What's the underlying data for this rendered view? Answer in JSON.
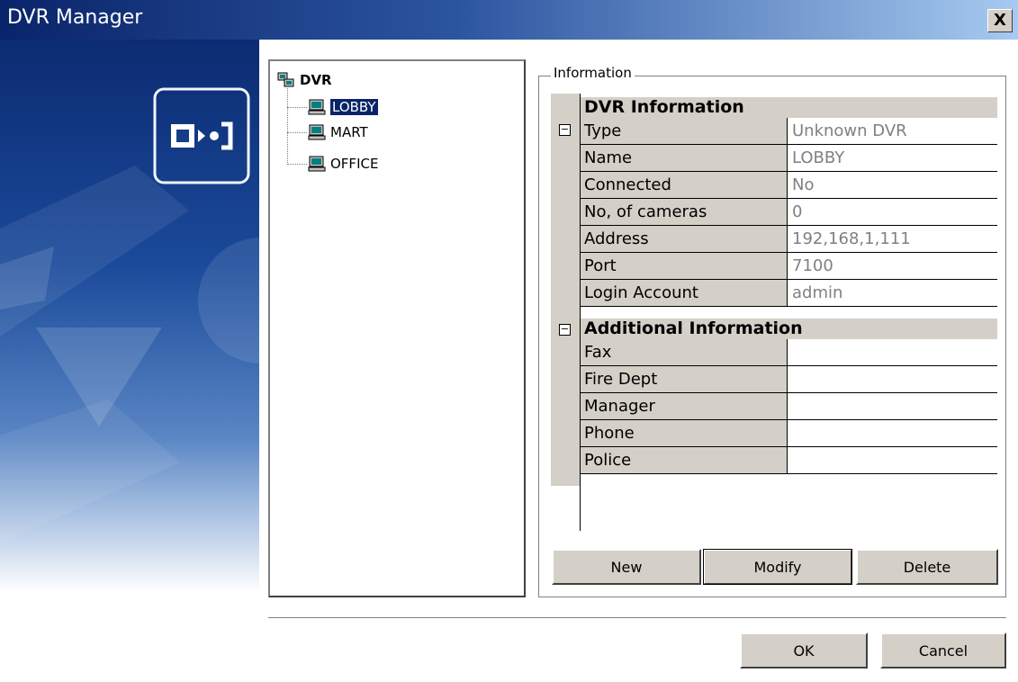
{
  "window": {
    "title": "DVR Manager",
    "close_label": "X"
  },
  "tree": {
    "root": "DVR",
    "items": [
      {
        "label": "LOBBY"
      },
      {
        "label": "MART"
      },
      {
        "label": "OFFICE"
      }
    ]
  },
  "info": {
    "group_label": "Information",
    "dvr_section": {
      "title": "DVR Information",
      "rows": [
        {
          "name": "Type",
          "value": "Unknown DVR"
        },
        {
          "name": "Name",
          "value": "LOBBY"
        },
        {
          "name": "Connected",
          "value": "No"
        },
        {
          "name": "No, of cameras",
          "value": "0"
        },
        {
          "name": "Address",
          "value": "192,168,1,111"
        },
        {
          "name": "Port",
          "value": "7100"
        },
        {
          "name": "Login Account",
          "value": "admin"
        }
      ]
    },
    "additional_section": {
      "title": "Additional Information",
      "rows": [
        {
          "name": "Fax",
          "value": ""
        },
        {
          "name": "Fire Dept",
          "value": ""
        },
        {
          "name": "Manager",
          "value": ""
        },
        {
          "name": "Phone",
          "value": ""
        },
        {
          "name": "Police",
          "value": ""
        }
      ]
    },
    "buttons": {
      "new": "New",
      "modify": "Modify",
      "delete": "Delete"
    }
  },
  "footer": {
    "ok": "OK",
    "cancel": "Cancel"
  }
}
